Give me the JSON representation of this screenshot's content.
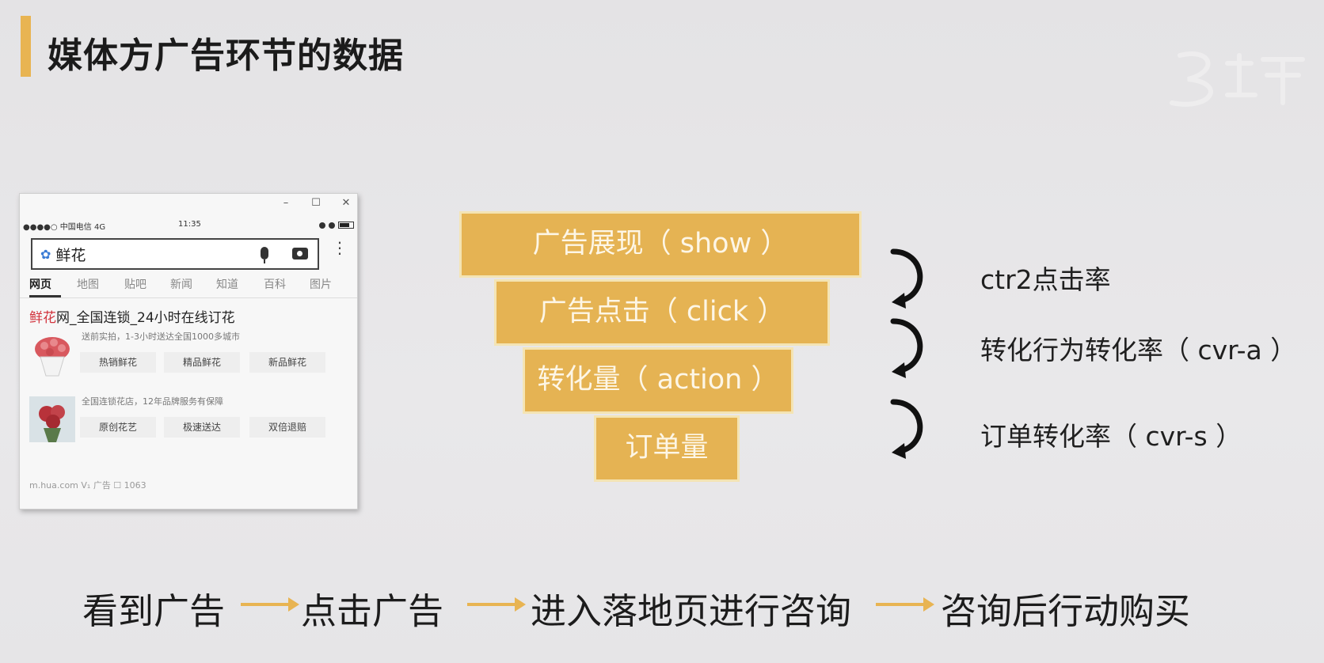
{
  "slide": {
    "title": "媒体方广告环节的数据",
    "accent_color": "#e8b452"
  },
  "mock_window": {
    "controls": [
      "–",
      "☐",
      "✕"
    ],
    "status_bar": {
      "carrier": "●●●●○ 中国电信  4G",
      "time": "11:35"
    },
    "search": {
      "query": "鲜花",
      "icons": [
        "paw-icon",
        "mic-icon",
        "camera-icon",
        "kebab-icon"
      ]
    },
    "tabs": [
      "网页",
      "地图",
      "贴吧",
      "新闻",
      "知道",
      "百科",
      "图片"
    ],
    "result": {
      "title_highlight": "鲜花",
      "title_rest": "网_全国连锁_24小时在线订花",
      "desc1": "送前实拍，1-3小时送达全国1000多城市",
      "chips1": [
        "热销鲜花",
        "精品鲜花",
        "新品鲜花"
      ],
      "desc2": "全国连锁花店，12年品牌服务有保障",
      "chips2": [
        "原创花艺",
        "极速送达",
        "双倍退赔"
      ],
      "meta": "m.hua.com  V₁  广告   ☐ 1063"
    }
  },
  "funnel": {
    "color": "#e5b353",
    "stages": [
      "广告展现（ show ）",
      "广告点击（ click ）",
      "转化量（ action ）",
      "订单量"
    ]
  },
  "rates": [
    "ctr2点击率",
    "转化行为转化率（ cvr-a ）",
    "订单转化率（ cvr-s ）"
  ],
  "flow": {
    "steps": [
      "看到广告",
      "点击广告",
      "进入落地页进行咨询",
      "咨询后行动购买"
    ],
    "arrow_color": "#e8b452"
  }
}
